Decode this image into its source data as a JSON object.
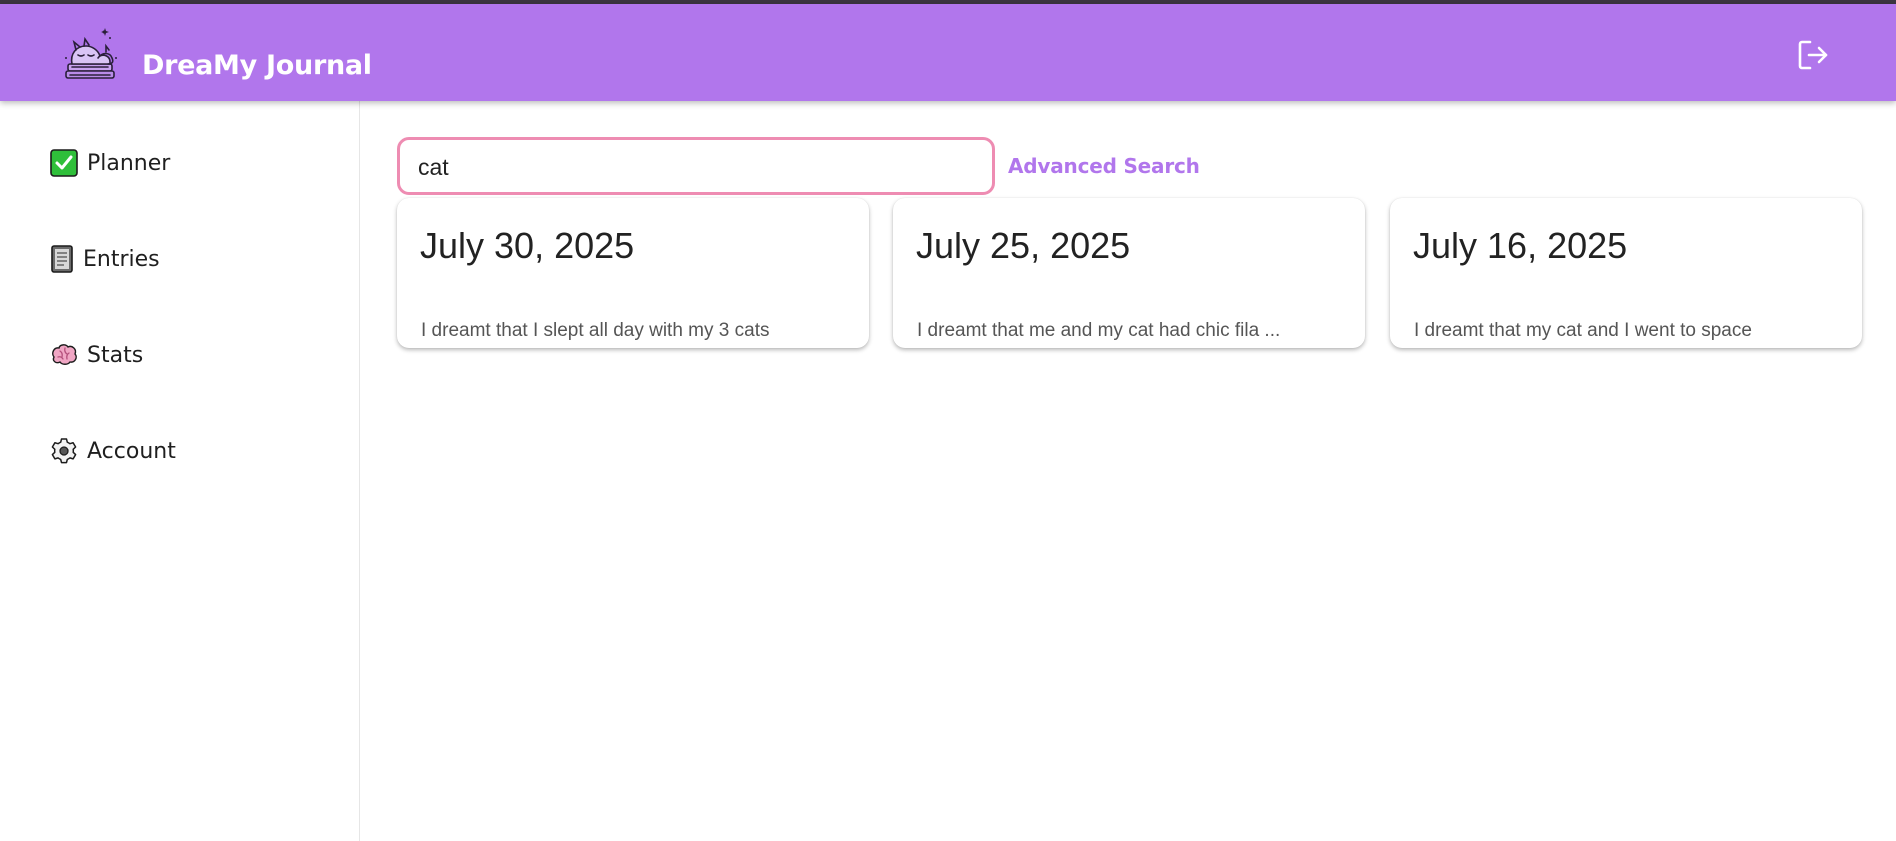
{
  "header": {
    "title": "DreaMy Journal",
    "logo_icon": "sleeping-cats-on-books-logo",
    "logout_icon": "logout-icon",
    "background_color": "#b176ec"
  },
  "sidebar": {
    "items": [
      {
        "label": "Planner",
        "icon": "check-box-icon"
      },
      {
        "label": "Entries",
        "icon": "notebook-icon"
      },
      {
        "label": "Stats",
        "icon": "brain-icon"
      },
      {
        "label": "Account",
        "icon": "gear-icon"
      }
    ]
  },
  "search": {
    "value": "cat",
    "placeholder": "",
    "border_color": "#ee8cb2",
    "advanced_label": "Advanced Search"
  },
  "entries": [
    {
      "date": "July 30, 2025",
      "snippet": "I dreamt that I slept all day with my 3 cats"
    },
    {
      "date": "July 25, 2025",
      "snippet": "I dreamt that me and my cat had chic fila ..."
    },
    {
      "date": "July 16, 2025",
      "snippet": "I dreamt that my cat and I went to space"
    }
  ],
  "colors": {
    "accent": "#b176ec",
    "search_border": "#ee8cb2"
  }
}
